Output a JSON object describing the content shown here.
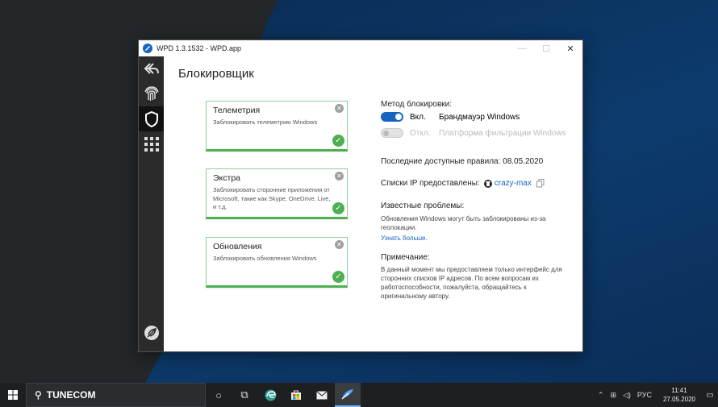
{
  "window": {
    "title": "WPD 1.3.1532 - WPD.app",
    "minimize": "—",
    "maximize": "☐",
    "close": "✕"
  },
  "page": {
    "title": "Блокировщик"
  },
  "cards": [
    {
      "title": "Телеметрия",
      "description": "Заблокировать телеметрию Windows"
    },
    {
      "title": "Экстра",
      "description": "Заблокировать сторонние приложения от Microsoft, такие как Skype, OneDrive, Live, и т.д."
    },
    {
      "title": "Обновления",
      "description": "Заблокировать обновления Windows"
    }
  ],
  "method": {
    "heading": "Метод блокировки:",
    "options": [
      {
        "state": "Вкл.",
        "label": "Брандмауэр Windows",
        "enabled": true
      },
      {
        "state": "Откл.",
        "label": "Платформа фильтрации Windows",
        "enabled": false
      }
    ]
  },
  "rules": {
    "text": "Последние доступные правила: 08.05.2020"
  },
  "ip_lists": {
    "label": "Списки IP предоставлены:",
    "provider": "crazy-max"
  },
  "known_issues": {
    "heading": "Известные проблемы:",
    "text": "Обновления Windows могут быть заблокированы из-за геолокации.",
    "link": "Узнать больше."
  },
  "note": {
    "heading": "Примечание:",
    "text": "В данный момент мы предоставляем только интерфейс для сторонних списков IP адресов. По всем вопросам их работоспособности, пожалуйста, обращайтесь к оригинальному автору."
  },
  "taskbar": {
    "search_text": "TUNECOM",
    "language": "РУС",
    "time": "11:41",
    "date": "27.05.2020"
  },
  "colors": {
    "accent": "#1565c0",
    "success": "#4caf50",
    "sidebar": "#2b2b2b"
  }
}
